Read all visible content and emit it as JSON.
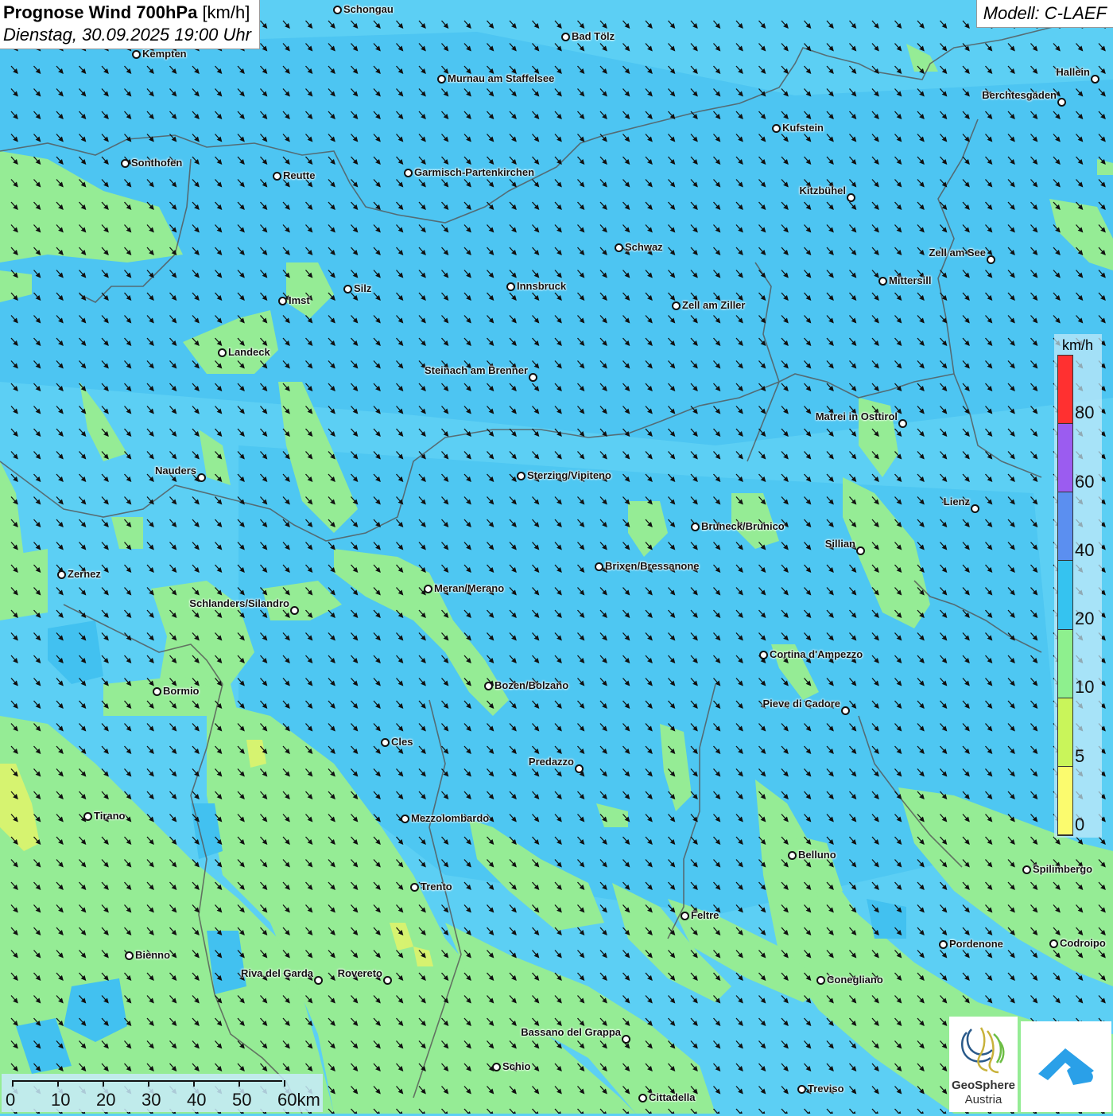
{
  "header": {
    "title_main": "Prognose Wind 700hPa",
    "title_unit": "[km/h]",
    "datetime": "Dienstag, 30.09.2025 19:00 Uhr",
    "model": "Modell: C-LAEF"
  },
  "legend": {
    "unit": "km/h",
    "labels": [
      "80",
      "60",
      "40",
      "20",
      "10",
      "5",
      "0"
    ],
    "colors": [
      "#ff3030",
      "#9b5cf0",
      "#5b8ff0",
      "#35c3f0",
      "#8ef08e",
      "#c9f55a",
      "#fbfb6e"
    ]
  },
  "scalebar": {
    "labels": [
      "0",
      "10",
      "20",
      "30",
      "40",
      "50",
      "60km"
    ]
  },
  "map": {
    "background_colors": {
      "wind_10_20": "#5ccff4",
      "wind_20_40": "#38b8ee",
      "wind_5_10": "#95ec95",
      "wind_0_5": "#e6f56a"
    },
    "wind_direction": "north-west to south-east"
  },
  "cities": [
    "Schongau",
    "Bad Tölz",
    "Kempten",
    "Murnau am Staffelsee",
    "Hallein",
    "Berchtesgaden",
    "Kufstein",
    "Sonthofen",
    "Reutte",
    "Garmisch-Partenkirchen",
    "Kitzbühel",
    "Schwaz",
    "Zell am See",
    "Innsbruck",
    "Mittersill",
    "Silz",
    "Imst",
    "Zell am Ziller",
    "Landeck",
    "Steinach am Brenner",
    "Matrei in Osttirol",
    "Nauders",
    "Sterzing/Vipiteno",
    "Lienz",
    "Bruneck/Brunico",
    "Sillian",
    "Zernez",
    "Brixen/Bressanone",
    "Meran/Merano",
    "Schlanders/Silandro",
    "Cortina d'Ampezzo",
    "Bozen/Bolzano",
    "Bormio",
    "Pieve di Cadore",
    "Cles",
    "Predazzo",
    "Tirano",
    "Mezzolombardo",
    "Belluno",
    "Spilimbergo",
    "Trento",
    "Feltre",
    "Bienno",
    "Pordenone",
    "Codroipo",
    "Riva del Garda",
    "Rovereto",
    "Conegliano",
    "Bassano del Grappa",
    "Schio",
    "Treviso",
    "Cittadella"
  ],
  "logos": {
    "geosphere_line1": "GeoSphere",
    "geosphere_line2": "Austria"
  }
}
